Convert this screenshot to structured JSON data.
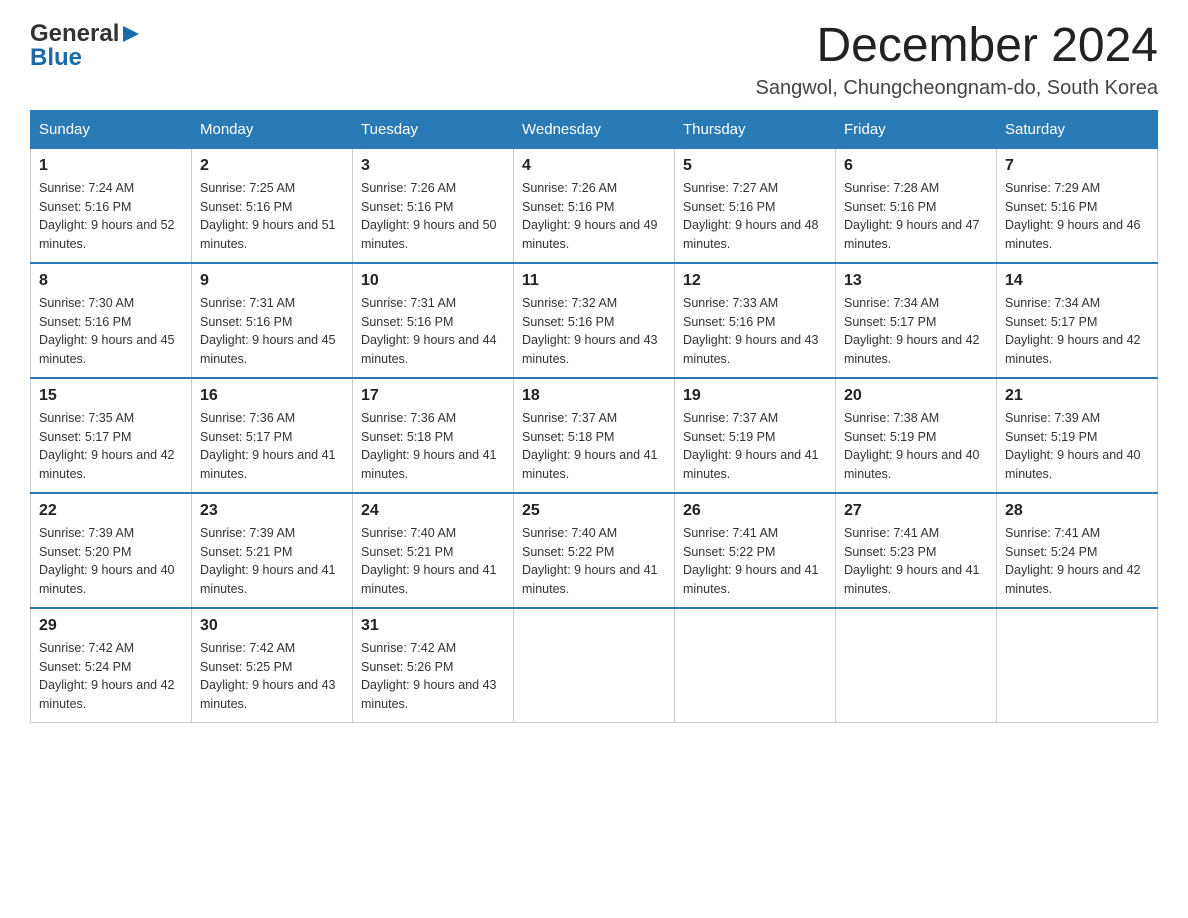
{
  "logo": {
    "line1": "General",
    "arrow": "▶",
    "line2": "Blue"
  },
  "header": {
    "title": "December 2024",
    "subtitle": "Sangwol, Chungcheongnam-do, South Korea"
  },
  "days_of_week": [
    "Sunday",
    "Monday",
    "Tuesday",
    "Wednesday",
    "Thursday",
    "Friday",
    "Saturday"
  ],
  "weeks": [
    [
      {
        "day": "1",
        "sunrise": "7:24 AM",
        "sunset": "5:16 PM",
        "daylight": "9 hours and 52 minutes."
      },
      {
        "day": "2",
        "sunrise": "7:25 AM",
        "sunset": "5:16 PM",
        "daylight": "9 hours and 51 minutes."
      },
      {
        "day": "3",
        "sunrise": "7:26 AM",
        "sunset": "5:16 PM",
        "daylight": "9 hours and 50 minutes."
      },
      {
        "day": "4",
        "sunrise": "7:26 AM",
        "sunset": "5:16 PM",
        "daylight": "9 hours and 49 minutes."
      },
      {
        "day": "5",
        "sunrise": "7:27 AM",
        "sunset": "5:16 PM",
        "daylight": "9 hours and 48 minutes."
      },
      {
        "day": "6",
        "sunrise": "7:28 AM",
        "sunset": "5:16 PM",
        "daylight": "9 hours and 47 minutes."
      },
      {
        "day": "7",
        "sunrise": "7:29 AM",
        "sunset": "5:16 PM",
        "daylight": "9 hours and 46 minutes."
      }
    ],
    [
      {
        "day": "8",
        "sunrise": "7:30 AM",
        "sunset": "5:16 PM",
        "daylight": "9 hours and 45 minutes."
      },
      {
        "day": "9",
        "sunrise": "7:31 AM",
        "sunset": "5:16 PM",
        "daylight": "9 hours and 45 minutes."
      },
      {
        "day": "10",
        "sunrise": "7:31 AM",
        "sunset": "5:16 PM",
        "daylight": "9 hours and 44 minutes."
      },
      {
        "day": "11",
        "sunrise": "7:32 AM",
        "sunset": "5:16 PM",
        "daylight": "9 hours and 43 minutes."
      },
      {
        "day": "12",
        "sunrise": "7:33 AM",
        "sunset": "5:16 PM",
        "daylight": "9 hours and 43 minutes."
      },
      {
        "day": "13",
        "sunrise": "7:34 AM",
        "sunset": "5:17 PM",
        "daylight": "9 hours and 42 minutes."
      },
      {
        "day": "14",
        "sunrise": "7:34 AM",
        "sunset": "5:17 PM",
        "daylight": "9 hours and 42 minutes."
      }
    ],
    [
      {
        "day": "15",
        "sunrise": "7:35 AM",
        "sunset": "5:17 PM",
        "daylight": "9 hours and 42 minutes."
      },
      {
        "day": "16",
        "sunrise": "7:36 AM",
        "sunset": "5:17 PM",
        "daylight": "9 hours and 41 minutes."
      },
      {
        "day": "17",
        "sunrise": "7:36 AM",
        "sunset": "5:18 PM",
        "daylight": "9 hours and 41 minutes."
      },
      {
        "day": "18",
        "sunrise": "7:37 AM",
        "sunset": "5:18 PM",
        "daylight": "9 hours and 41 minutes."
      },
      {
        "day": "19",
        "sunrise": "7:37 AM",
        "sunset": "5:19 PM",
        "daylight": "9 hours and 41 minutes."
      },
      {
        "day": "20",
        "sunrise": "7:38 AM",
        "sunset": "5:19 PM",
        "daylight": "9 hours and 40 minutes."
      },
      {
        "day": "21",
        "sunrise": "7:39 AM",
        "sunset": "5:19 PM",
        "daylight": "9 hours and 40 minutes."
      }
    ],
    [
      {
        "day": "22",
        "sunrise": "7:39 AM",
        "sunset": "5:20 PM",
        "daylight": "9 hours and 40 minutes."
      },
      {
        "day": "23",
        "sunrise": "7:39 AM",
        "sunset": "5:21 PM",
        "daylight": "9 hours and 41 minutes."
      },
      {
        "day": "24",
        "sunrise": "7:40 AM",
        "sunset": "5:21 PM",
        "daylight": "9 hours and 41 minutes."
      },
      {
        "day": "25",
        "sunrise": "7:40 AM",
        "sunset": "5:22 PM",
        "daylight": "9 hours and 41 minutes."
      },
      {
        "day": "26",
        "sunrise": "7:41 AM",
        "sunset": "5:22 PM",
        "daylight": "9 hours and 41 minutes."
      },
      {
        "day": "27",
        "sunrise": "7:41 AM",
        "sunset": "5:23 PM",
        "daylight": "9 hours and 41 minutes."
      },
      {
        "day": "28",
        "sunrise": "7:41 AM",
        "sunset": "5:24 PM",
        "daylight": "9 hours and 42 minutes."
      }
    ],
    [
      {
        "day": "29",
        "sunrise": "7:42 AM",
        "sunset": "5:24 PM",
        "daylight": "9 hours and 42 minutes."
      },
      {
        "day": "30",
        "sunrise": "7:42 AM",
        "sunset": "5:25 PM",
        "daylight": "9 hours and 43 minutes."
      },
      {
        "day": "31",
        "sunrise": "7:42 AM",
        "sunset": "5:26 PM",
        "daylight": "9 hours and 43 minutes."
      },
      null,
      null,
      null,
      null
    ]
  ]
}
